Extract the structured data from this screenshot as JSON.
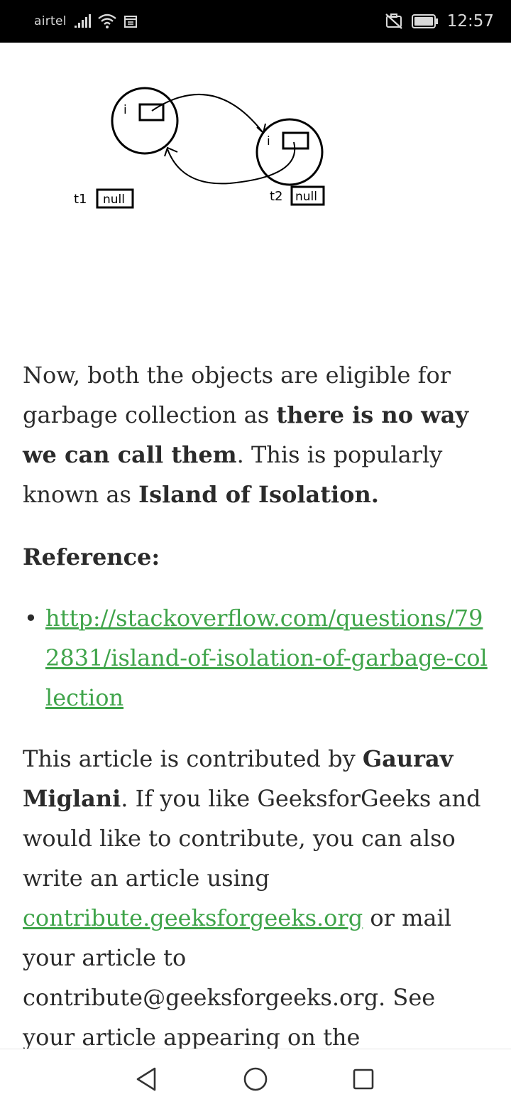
{
  "status_bar": {
    "carrier": "airtel",
    "time": "12:57",
    "icons": [
      "signal-icon",
      "wifi-icon",
      "calendar-icon",
      "no-sim-icon",
      "battery-icon"
    ]
  },
  "diagram": {
    "field_i_left": "i",
    "field_i_right": "i",
    "t1_label": "t1",
    "t1_value": "null",
    "t2_label": "t2",
    "t2_value": "null"
  },
  "article": {
    "p1_a": "Now, both the objects are eligible for garbage collection as ",
    "p1_bold1": "there is no way we can call them",
    "p1_b": ". This is popularly known as ",
    "p1_bold2": "Island of Isolation.",
    "reference_heading": "Reference:",
    "reference_link": "http://stackoverflow.com/questions/792831/island-of-isolation-of-garbage-collection",
    "p2_a": "This article is contributed by ",
    "p2_author": "Gaurav Miglani",
    "p2_b": ". If you like GeeksforGeeks and would like to contribute, you can also write an article using ",
    "p2_link": "contribute.geeksforgeeks.org",
    "p2_c": " or mail your article to contribute@geeksforgeeks.org. See your article appearing on the GeeksforGeeks main page and help other Geeks."
  },
  "nav_bar": {
    "buttons": [
      "back-icon",
      "home-icon",
      "recents-icon"
    ]
  }
}
